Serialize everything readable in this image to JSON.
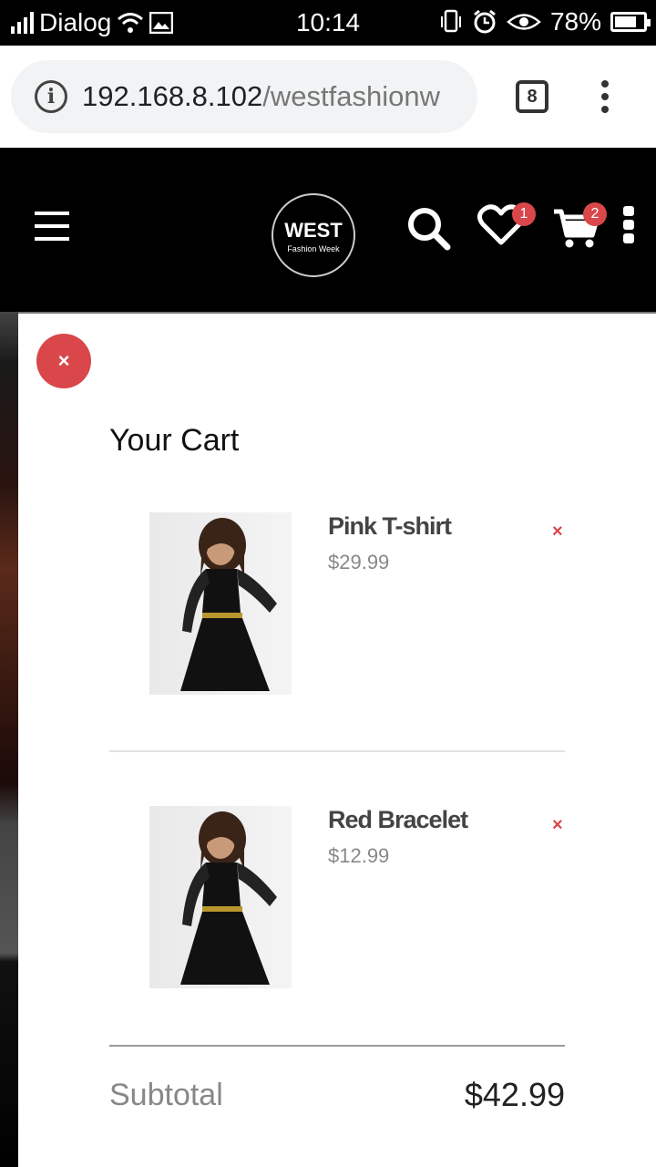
{
  "status_bar": {
    "carrier": "Dialog",
    "time": "10:14",
    "battery": "78%",
    "battery_level": 0.78
  },
  "browser": {
    "url_host": "192.168.8.102",
    "url_path": "/westfashionw",
    "tab_count": "8"
  },
  "header": {
    "logo_main": "WEST",
    "logo_sub": "Fashion Week",
    "wishlist_count": "1",
    "cart_count": "2"
  },
  "cart": {
    "close_label": "×",
    "title": "Your Cart",
    "items": [
      {
        "name": "Pink T-shirt",
        "price": "$29.99",
        "remove": "×"
      },
      {
        "name": "Red Bracelet",
        "price": "$12.99",
        "remove": "×"
      }
    ],
    "subtotal_label": "Subtotal",
    "subtotal_value": "$42.99"
  },
  "colors": {
    "accent": "#d9474b",
    "header_bg": "#000000"
  }
}
